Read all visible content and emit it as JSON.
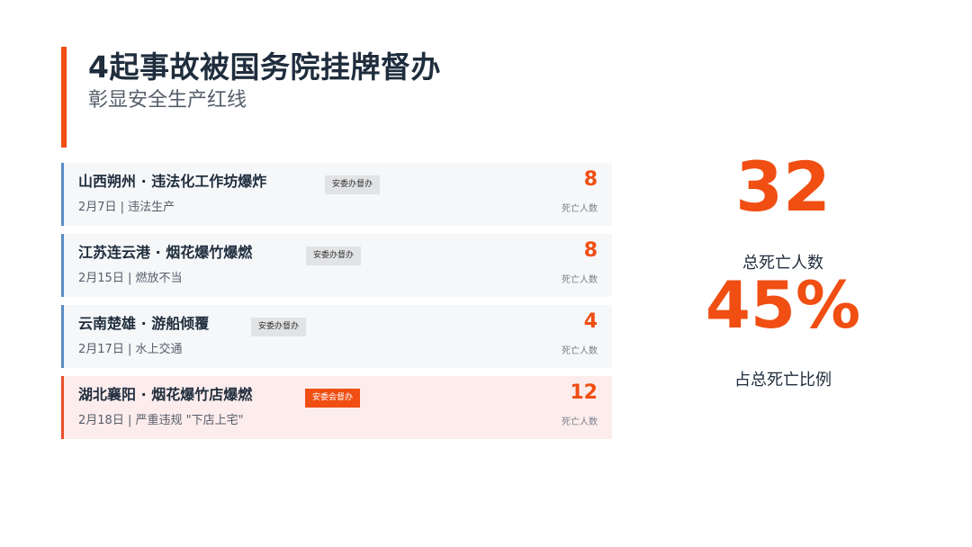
{
  "header": {
    "title": "4起事故被国务院挂牌督办",
    "subtitle": "彰显安全生产红线"
  },
  "colors": {
    "accent": "#f04e12",
    "card_border": "#5b8cc4",
    "card_bg": "#f6f7f9",
    "highlight_bg": "#fdecec"
  },
  "cards": [
    {
      "title": "山西朔州 · 违法化工作坊爆炸",
      "sub": "2月7日 | 违法生产",
      "badge": "安委办督办",
      "number": "8",
      "number_label": "死亡人数",
      "highlight": false
    },
    {
      "title": "江苏连云港 · 烟花爆竹爆燃",
      "sub": "2月15日 | 燃放不当",
      "badge": "安委办督办",
      "number": "8",
      "number_label": "死亡人数",
      "highlight": false
    },
    {
      "title": "云南楚雄 · 游船倾覆",
      "sub": "2月17日 | 水上交通",
      "badge": "安委办督办",
      "number": "4",
      "number_label": "死亡人数",
      "highlight": false
    },
    {
      "title": "湖北襄阳 · 烟花爆竹店爆燃",
      "sub": "2月18日 | 严重违规 \"下店上宅\"",
      "badge": "安委会督办",
      "number": "12",
      "number_label": "死亡人数",
      "highlight": true
    }
  ],
  "stats": {
    "total": "32",
    "total_label": "总死亡人数",
    "percent": "45%",
    "percent_label": "占总死亡比例"
  }
}
